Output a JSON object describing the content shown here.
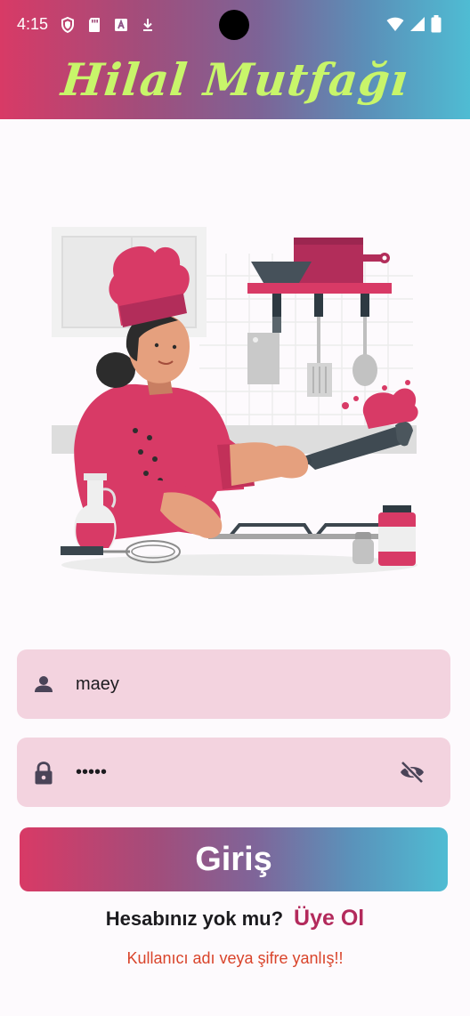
{
  "status_bar": {
    "time": "4:15",
    "icons_left": [
      "shield-icon",
      "sd-card-icon",
      "font-icon",
      "download-icon"
    ],
    "icons_right": [
      "wifi-icon",
      "signal-icon",
      "battery-icon"
    ]
  },
  "app": {
    "title": "Hilal Mutfağı",
    "title_color": "#c8f56a",
    "header_gradient": [
      "#d83a66",
      "#7d6396",
      "#4fbcd3"
    ]
  },
  "form": {
    "username": {
      "value": "maey",
      "icon": "person-icon"
    },
    "password": {
      "value": "•••••",
      "icon": "lock-icon",
      "toggle_icon": "visibility-off-icon"
    },
    "login_label": "Giriş",
    "signup_question": "Hesabınız yok mu?",
    "signup_link": "Üye Ol",
    "error_message": "Kullanıcı adı veya şifre yanlış!!",
    "field_bg": "#f3d3df",
    "link_color": "#b32a5c",
    "error_color": "#d9442b"
  }
}
